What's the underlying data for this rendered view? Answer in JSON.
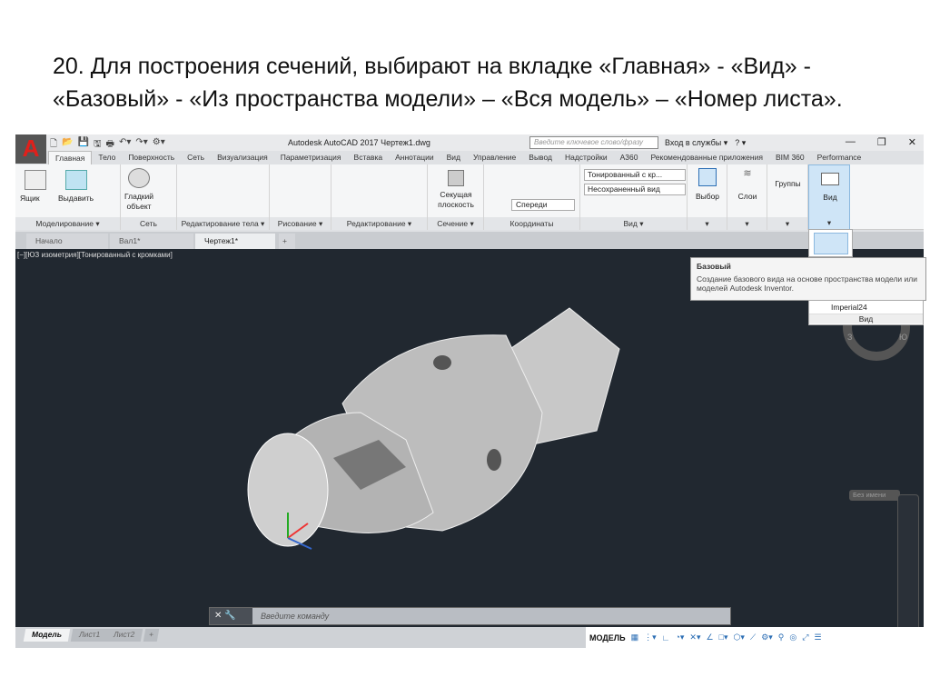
{
  "slide_title": "20. Для построения сечений, выбирают на вкладке «Главная» - «Вид» - «Базовый» - «Из пространства модели» – «Вся модель» – «Номер листа».",
  "app": {
    "title": "Autodesk AutoCAD 2017   Чертеж1.dwg",
    "search_placeholder": "Введите ключевое слово/фразу",
    "login": "Вход в службы ▾",
    "help": "? ▾",
    "min": "—",
    "max": "❐",
    "close": "✕",
    "logo": "A"
  },
  "ribbon_tabs": [
    "Главная",
    "Тело",
    "Поверхность",
    "Сеть",
    "Визуализация",
    "Параметризация",
    "Вставка",
    "Аннотации",
    "Вид",
    "Управление",
    "Вывод",
    "Надстройки",
    "A360",
    "Рекомендованные приложения",
    "BIM 360",
    "Performance"
  ],
  "panels": {
    "modeling": "Моделирование ▾",
    "mesh": "Сеть",
    "solid_edit": "Редактирование тела ▾",
    "draw": "Рисование ▾",
    "modify": "Редактирование ▾",
    "section": "Сечение ▾",
    "coords": "Координаты",
    "view": "Вид ▾"
  },
  "buttons": {
    "box": "Ящик",
    "extrude": "Выдавить",
    "smooth": "Гладкий объект",
    "section_plane": "Секущая плоскость",
    "visual_style": "Тонированный с кр...",
    "named_view": "Несохраненный вид",
    "front": "Спереди",
    "select": "Выбор",
    "layers": "Слои",
    "groups": "Группы",
    "view": "Вид"
  },
  "doc_tabs": [
    "Начало",
    "Вал1*",
    "Чертеж1*"
  ],
  "viewport_label": "[−][ЮЗ изометрия][Тонированный с кромками]",
  "tooltip": {
    "title": "Базовый",
    "text": "Создание базового вида на основе пространства модели или моделей Autodesk Inventor."
  },
  "imperial": "Imperial24",
  "vid_panel": "Вид",
  "viewcube": {
    "w": "З",
    "s": "Ю",
    "unnamed": "Без имени"
  },
  "command_placeholder": "Введите команду",
  "layout_tabs": [
    "Модель",
    "Лист1",
    "Лист2",
    "+"
  ],
  "status_model": "МОДЕЛЬ"
}
